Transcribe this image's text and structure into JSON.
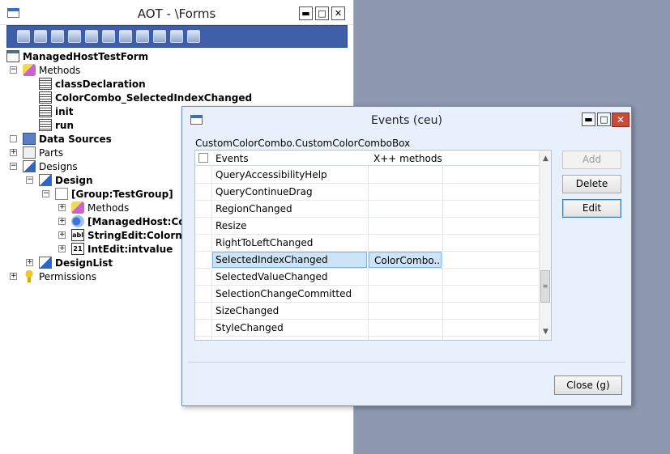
{
  "aot": {
    "title": "AOT - \\Forms",
    "minimize_glyph": "▬",
    "maximize_glyph": "□",
    "close_glyph": "✕",
    "toolbar_icons": [
      "open-icon",
      "properties-icon",
      "compile-icon",
      "import-icon",
      "save-icon",
      "new-icon",
      "add-icon",
      "move-icon",
      "undo-icon",
      "refresh-icon",
      "settings-icon"
    ],
    "tree": {
      "expand_glyph": "+",
      "collapse_glyph": "−",
      "string_glyph": "abl",
      "int_glyph": "21",
      "root": "ManagedHostTestForm",
      "methods": "Methods",
      "class_declaration": "classDeclaration",
      "color_combo_method": "ColorCombo_SelectedIndexChanged",
      "init": "init",
      "run": "run",
      "data_sources": "Data Sources",
      "parts": "Parts",
      "designs": "Designs",
      "design": "Design",
      "group": "[Group:TestGroup]",
      "group_methods": "Methods",
      "managed_host": "[ManagedHost:Color",
      "string_edit": "StringEdit:Colorname",
      "int_edit": "IntEdit:intvalue",
      "design_list": "DesignList",
      "permissions": "Permissions"
    }
  },
  "events_dialog": {
    "title": "Events (ceu)",
    "minimize_glyph": "▬",
    "maximize_glyph": "□",
    "close_glyph": "✕",
    "path": "CustomColorCombo.CustomColorComboBox",
    "columns": {
      "events": "Events",
      "methods": "X++ methods"
    },
    "rows": [
      {
        "event": "QueryAccessibilityHelp",
        "method": ""
      },
      {
        "event": "QueryContinueDrag",
        "method": ""
      },
      {
        "event": "RegionChanged",
        "method": ""
      },
      {
        "event": "Resize",
        "method": ""
      },
      {
        "event": "RightToLeftChanged",
        "method": ""
      },
      {
        "event": "SelectedIndexChanged",
        "method": "ColorCombo..."
      },
      {
        "event": "SelectedValueChanged",
        "method": ""
      },
      {
        "event": "SelectionChangeCommitted",
        "method": ""
      },
      {
        "event": "SizeChanged",
        "method": ""
      },
      {
        "event": "StyleChanged",
        "method": ""
      }
    ],
    "selected_row": "SelectedIndexChanged",
    "scroll_up_glyph": "▲",
    "scroll_down_glyph": "▼",
    "scroll_thumb_glyph": "≡",
    "buttons": {
      "add": "Add",
      "delete": "Delete",
      "edit": "Edit",
      "close": "Close (g)"
    }
  }
}
